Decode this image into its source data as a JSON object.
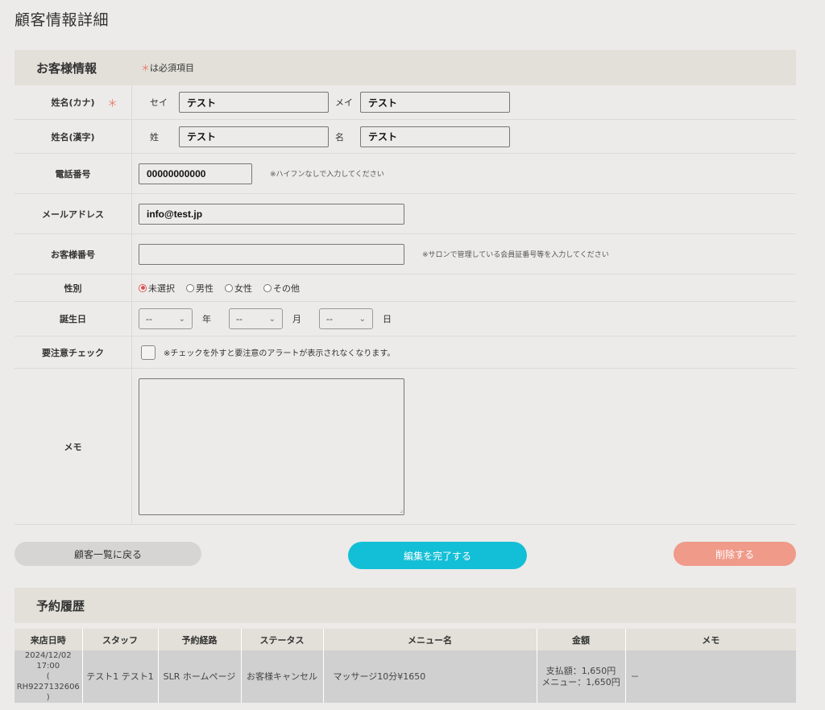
{
  "page_title": "顧客情報詳細",
  "customer_section": {
    "title": "お客様情報",
    "required_star": "＊",
    "required_note": "は必須項目"
  },
  "fields": {
    "name_kana": {
      "label": "姓名(カナ)",
      "required_star": "＊",
      "sei_label": "セイ",
      "sei_value": "テスト",
      "mei_label": "メイ",
      "mei_value": "テスト"
    },
    "name_kanji": {
      "label": "姓名(漢字)",
      "sei_label": "姓",
      "sei_value": "テスト",
      "mei_label": "名",
      "mei_value": "テスト"
    },
    "phone": {
      "label": "電話番号",
      "value": "00000000000",
      "hint": "※ハイフンなしで入力してください"
    },
    "email": {
      "label": "メールアドレス",
      "value": "info@test.jp"
    },
    "customer_number": {
      "label": "お客様番号",
      "value": "",
      "hint": "※サロンで管理している会員証番号等を入力してください"
    },
    "gender": {
      "label": "性別",
      "options": [
        "未選択",
        "男性",
        "女性",
        "その他"
      ],
      "selected": "未選択"
    },
    "birthday": {
      "label": "誕生日",
      "year_value": "--",
      "year_label": "年",
      "month_value": "--",
      "month_label": "月",
      "day_value": "--",
      "day_label": "日"
    },
    "caution": {
      "label": "要注意チェック",
      "checked": false,
      "note": "※チェックを外すと要注意のアラートが表示されなくなります。"
    },
    "memo": {
      "label": "メモ",
      "value": ""
    }
  },
  "buttons": {
    "back": "顧客一覧に戻る",
    "complete": "編集を完了する",
    "delete": "削除する"
  },
  "history_section": {
    "title": "予約履歴",
    "columns": [
      "来店日時",
      "スタッフ",
      "予約経路",
      "ステータス",
      "メニュー名",
      "金額",
      "メモ"
    ],
    "rows": [
      {
        "datetime": "2024/12/02 17:00",
        "reservation_id": "( RH9227132606 )",
        "staff": "テスト1 テスト1",
        "route": "SLR ホームページ",
        "status": "お客様キャンセル",
        "menu": "マッサージ10分¥1650",
        "amount_paid": "支払額：1,650円",
        "amount_menu": "メニュー：1,650円",
        "memo": "－"
      }
    ]
  },
  "colors": {
    "background": "#ecebe9",
    "header_bg": "#e2e0d9",
    "accent_cyan": "#13bfd6",
    "delete_salmon": "#f09a8a",
    "required_star": "#e97b6a"
  }
}
